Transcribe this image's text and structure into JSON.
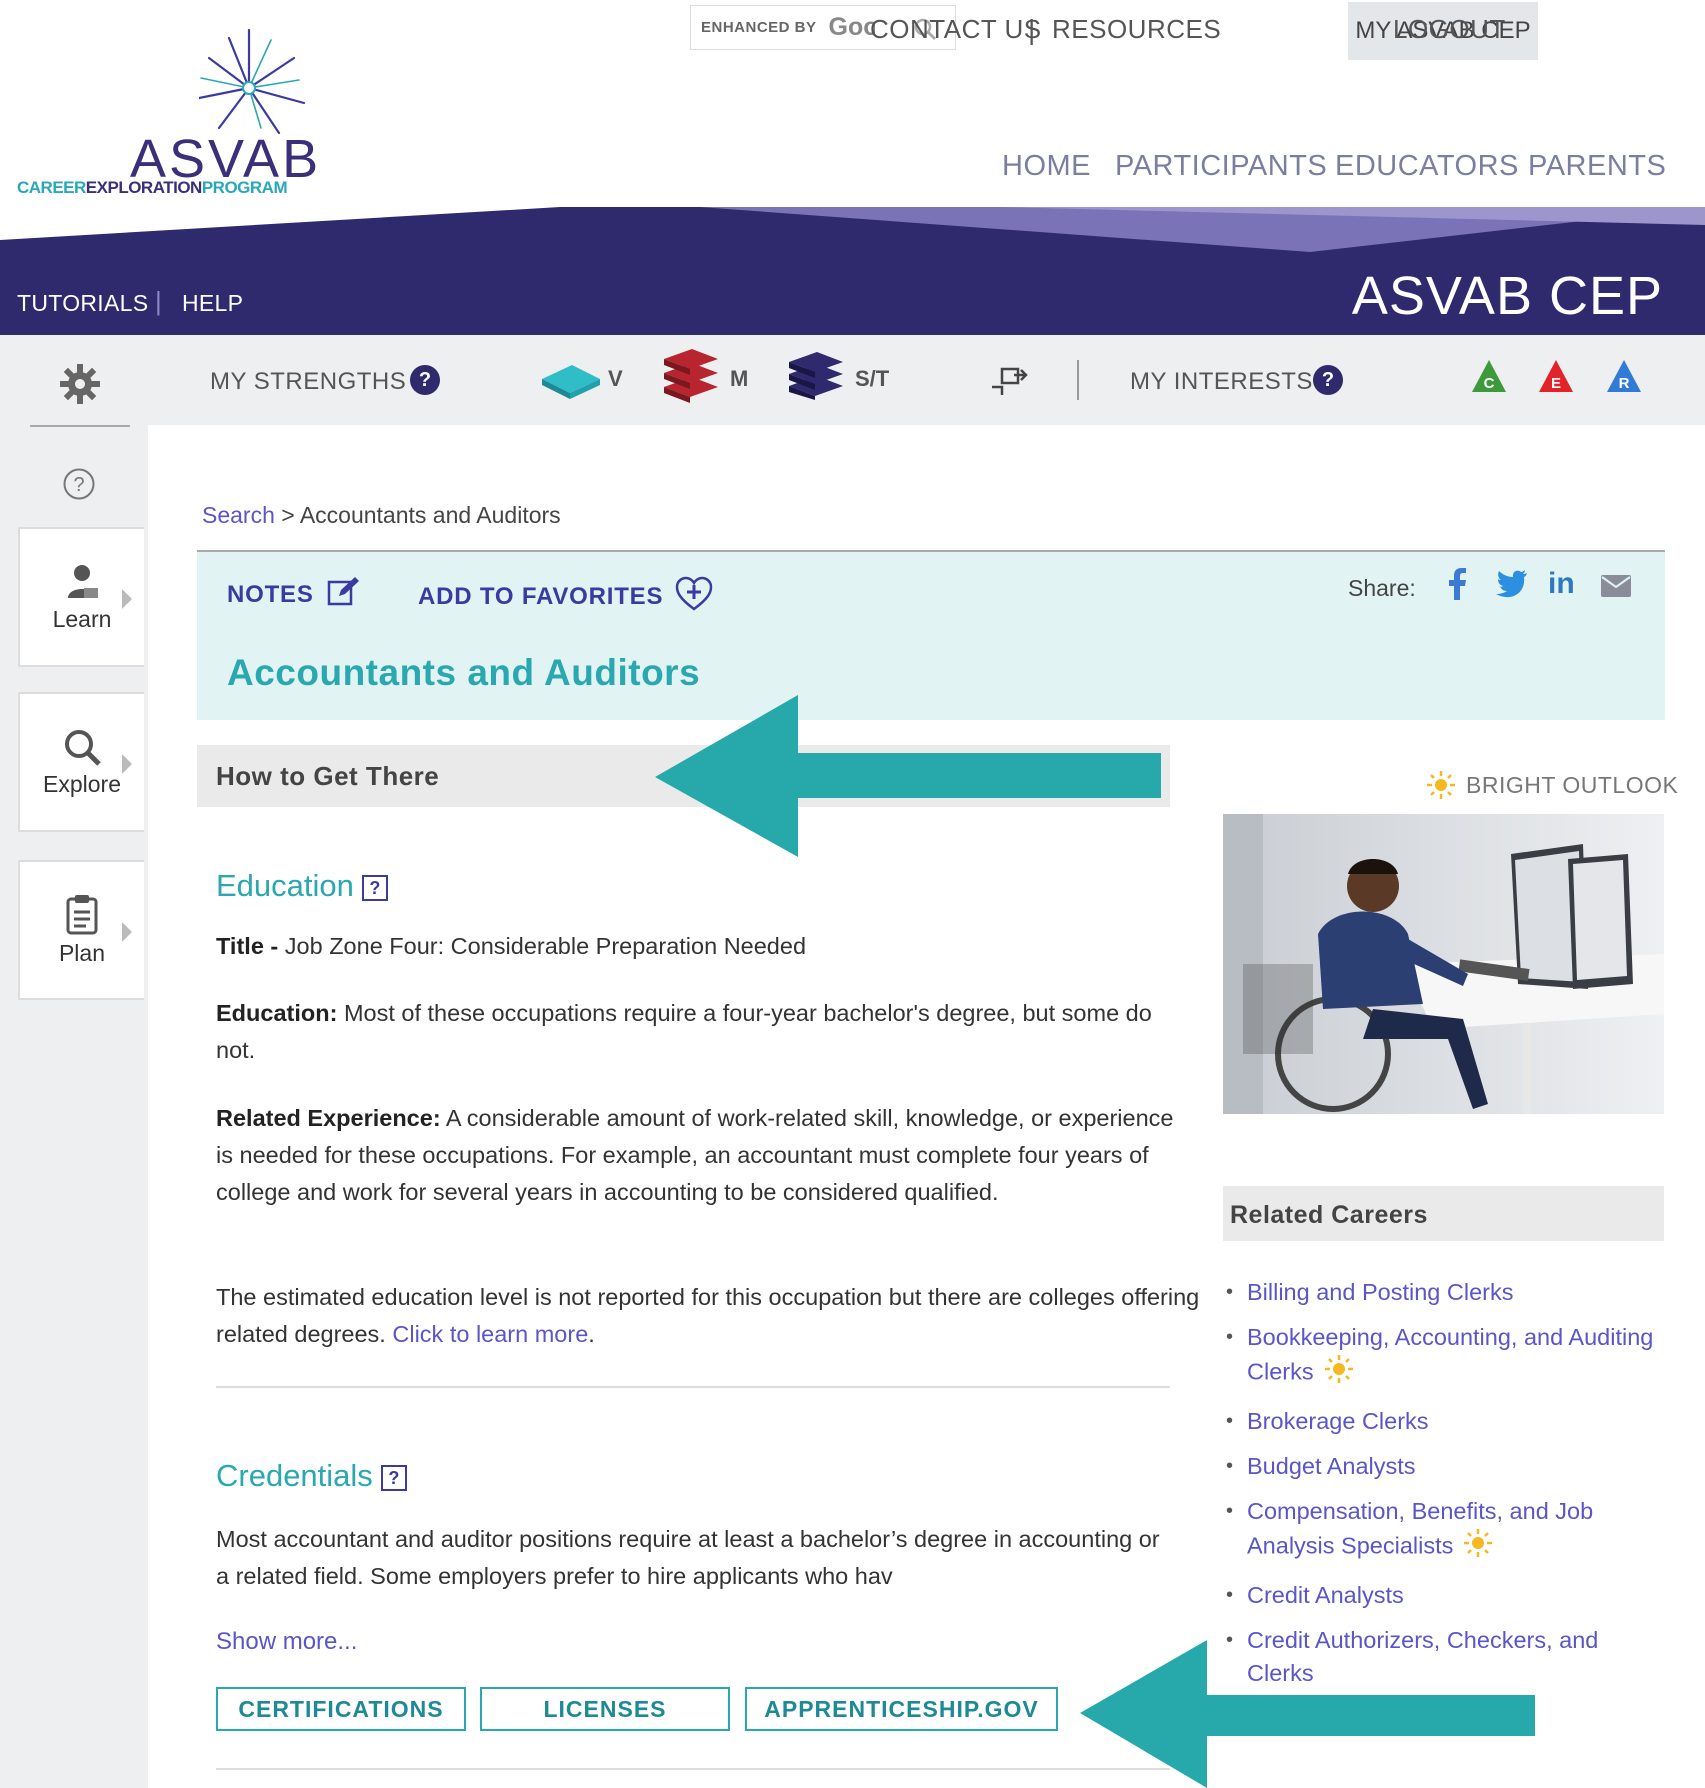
{
  "utility": {
    "search_enhanced": "ENHANCED BY",
    "search_brand": "Google",
    "contact": "CONTACT US",
    "separator": "|",
    "resources": "RESOURCES",
    "my_asvab": "MY ASVAB CEP",
    "logout": "LOGOUT"
  },
  "logo": {
    "name": "ASVAB",
    "tag_career": "CAREER",
    "tag_exploration": "EXPLORATION",
    "tag_program": "PROGRAM"
  },
  "main_nav": [
    "HOME",
    "PARTICIPANTS",
    "EDUCATORS",
    "PARENTS"
  ],
  "banner": {
    "tutorials": "TUTORIALS",
    "help": "HELP",
    "title": "ASVAB CEP"
  },
  "toolbar": {
    "strengths": "MY STRENGTHS",
    "verbal": "V",
    "math": "M",
    "science": "S/T",
    "interests": "MY INTERESTS",
    "interest_codes": [
      "C",
      "E",
      "R"
    ],
    "interest_colors": [
      "#3d9a3a",
      "#e2232a",
      "#2f7bd6"
    ],
    "help_glyph": "?"
  },
  "sidebar": {
    "learn": "Learn",
    "explore": "Explore",
    "plan": "Plan"
  },
  "breadcrumb": {
    "search": "Search",
    "sep": " > ",
    "current": "Accountants and Auditors"
  },
  "occupation": {
    "notes": "NOTES",
    "favorites": "ADD TO FAVORITES",
    "share": "Share:",
    "title": "Accountants and Auditors"
  },
  "how_to": {
    "heading": "How to Get There",
    "education_h": "Education",
    "title_label": "Title -",
    "title_value": " Job Zone Four: Considerable Preparation Needed",
    "education_label": "Education:",
    "education_value": " Most of these occupations require a four-year bachelor's degree, but some do not.",
    "experience_label": "Related Experience:",
    "experience_value": " A considerable amount of work-related skill, knowledge, or experience is needed for these occupations. For example, an accountant must complete four years of college and work for several years in accounting to be considered qualified.",
    "estimate_text": "The estimated education level is not reported for this occupation but there are colleges offering related degrees. ",
    "learn_more": "Click to learn more",
    "period": ".",
    "credentials_h": "Credentials",
    "credentials_text": "Most accountant and auditor positions require at least a bachelor’s degree in accounting or a related field. Some employers prefer to hire applicants who hav",
    "show_more": "Show more...",
    "buttons": [
      "CERTIFICATIONS",
      "LICENSES",
      "APPRENTICESHIP.GOV"
    ],
    "help_glyph": "?"
  },
  "right": {
    "bright_outlook": "BRIGHT OUTLOOK",
    "related_heading": "Related Careers",
    "related": [
      {
        "label": "Billing and Posting Clerks",
        "bright": false
      },
      {
        "label": "Bookkeeping, Accounting, and Auditing Clerks",
        "bright": true
      },
      {
        "label": "Brokerage Clerks",
        "bright": false
      },
      {
        "label": "Budget Analysts",
        "bright": false
      },
      {
        "label": "Compensation, Benefits, and Job Analysis Specialists",
        "bright": true
      },
      {
        "label": "Credit Analysts",
        "bright": false
      },
      {
        "label": "Credit Authorizers, Checkers, and Clerks",
        "bright": false
      }
    ]
  },
  "colors": {
    "brand_purple": "#2f2a6e",
    "teal": "#2aa8b0",
    "link": "#5a55c8",
    "arrow": "#27a9ab"
  }
}
